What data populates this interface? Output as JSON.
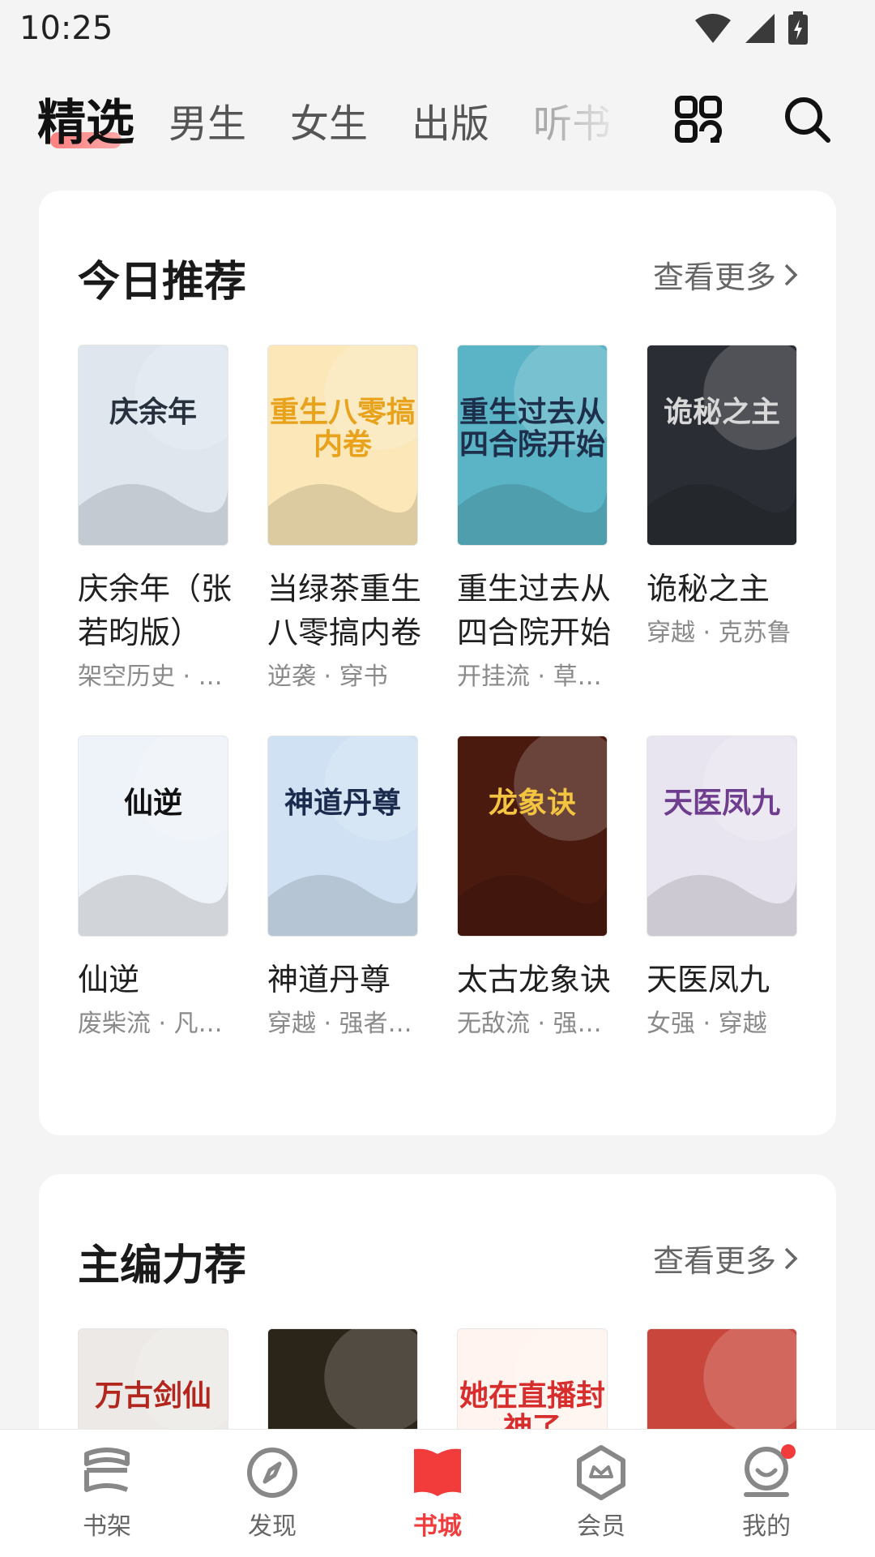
{
  "status_bar": {
    "time": "10:25"
  },
  "top_tabs": [
    {
      "label": "精选",
      "active": true
    },
    {
      "label": "男生",
      "active": false
    },
    {
      "label": "女生",
      "active": false
    },
    {
      "label": "出版",
      "active": false
    },
    {
      "label": "听书",
      "active": false
    }
  ],
  "sections": [
    {
      "title": "今日推荐",
      "more_label": "查看更多",
      "books": [
        {
          "title": "庆余年（张若昀版）",
          "tags": "架空历史 · 权谋",
          "cover_text": "庆余年",
          "cover_color": "#dfe6ee",
          "cover_text_color": "#27313d"
        },
        {
          "title": "当绿茶重生八零搞内卷",
          "tags": "逆袭 · 穿书",
          "cover_text": "重生八零搞内卷",
          "cover_color": "#fbe7b8",
          "cover_text_color": "#e8a21c"
        },
        {
          "title": "重生过去从四合院开始",
          "tags": "开挂流 · 草根崛起",
          "cover_text": "重生过去从四合院开始",
          "cover_color": "#5bb4c6",
          "cover_text_color": "#1d2f4a"
        },
        {
          "title": "诡秘之主",
          "tags": "穿越 · 克苏鲁",
          "cover_text": "诡秘之主",
          "cover_color": "#2a2d33",
          "cover_text_color": "#d8d8d8"
        },
        {
          "title": "仙逆",
          "tags": "废柴流 · 凡人流",
          "cover_text": "仙逆",
          "cover_color": "#eef3f9",
          "cover_text_color": "#111111"
        },
        {
          "title": "神道丹尊",
          "tags": "穿越 · 强者回归",
          "cover_text": "神道丹尊",
          "cover_color": "#cfe1f2",
          "cover_text_color": "#1b2b4d"
        },
        {
          "title": "太古龙象诀",
          "tags": "无敌流 · 强者回归",
          "cover_text": "龙象诀",
          "cover_color": "#4a1a0f",
          "cover_text_color": "#f3c440"
        },
        {
          "title": "天医凤九",
          "tags": "女强 · 穿越",
          "cover_text": "天医凤九",
          "cover_color": "#e9e5f0",
          "cover_text_color": "#6e3d8e"
        }
      ]
    },
    {
      "title": "主编力荐",
      "more_label": "查看更多",
      "books": [
        {
          "cover_text": "万古剑仙",
          "cover_color": "#ece9e6",
          "cover_text_color": "#b3261e"
        },
        {
          "cover_text": "",
          "cover_color": "#2b2418",
          "cover_text_color": "#e4c07a"
        },
        {
          "cover_text": "她在直播封神了",
          "cover_color": "#fff4ef",
          "cover_text_color": "#d72d2d"
        },
        {
          "cover_text": "",
          "cover_color": "#c8463b",
          "cover_text_color": "#ffffff"
        }
      ]
    }
  ],
  "bottom_nav": [
    {
      "label": "书架",
      "icon": "bookshelf-icon",
      "active": false
    },
    {
      "label": "发现",
      "icon": "compass-icon",
      "active": false
    },
    {
      "label": "书城",
      "icon": "book-store-icon",
      "active": true
    },
    {
      "label": "会员",
      "icon": "vip-icon",
      "active": false
    },
    {
      "label": "我的",
      "icon": "profile-icon",
      "active": false
    }
  ],
  "colors": {
    "accent": "#f23c3c",
    "background": "#f4f4f4",
    "card": "#ffffff"
  }
}
